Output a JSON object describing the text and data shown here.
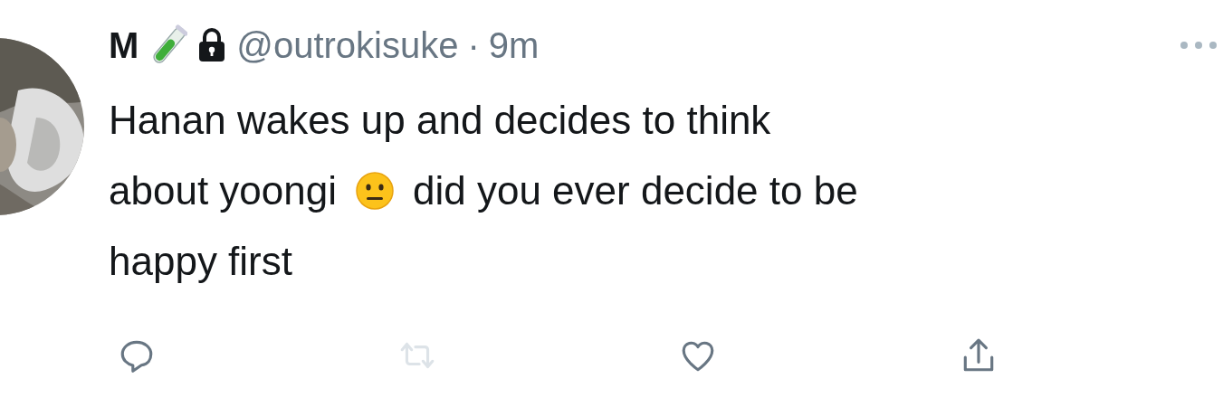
{
  "avatar": {
    "kind": "picture"
  },
  "author": {
    "name": "M",
    "badges": [
      {
        "kind": "test-tube"
      },
      {
        "kind": "lock"
      }
    ],
    "handle": "@outrokisuke",
    "separator": "·",
    "time": "9m"
  },
  "body_lines": [
    [
      {
        "kind": "text",
        "text": "Hanan wakes up and decides to think"
      }
    ],
    [
      {
        "kind": "text",
        "text": "about yoongi"
      },
      {
        "kind": "emoji"
      },
      {
        "kind": "text",
        "text": "did you ever decide to be"
      }
    ],
    [
      {
        "kind": "text",
        "text": "happy first"
      }
    ]
  ],
  "actions": [
    {
      "kind": "reply",
      "disabled": false
    },
    {
      "kind": "retweet",
      "disabled": true
    },
    {
      "kind": "like",
      "disabled": false
    },
    {
      "kind": "share",
      "disabled": false
    }
  ]
}
